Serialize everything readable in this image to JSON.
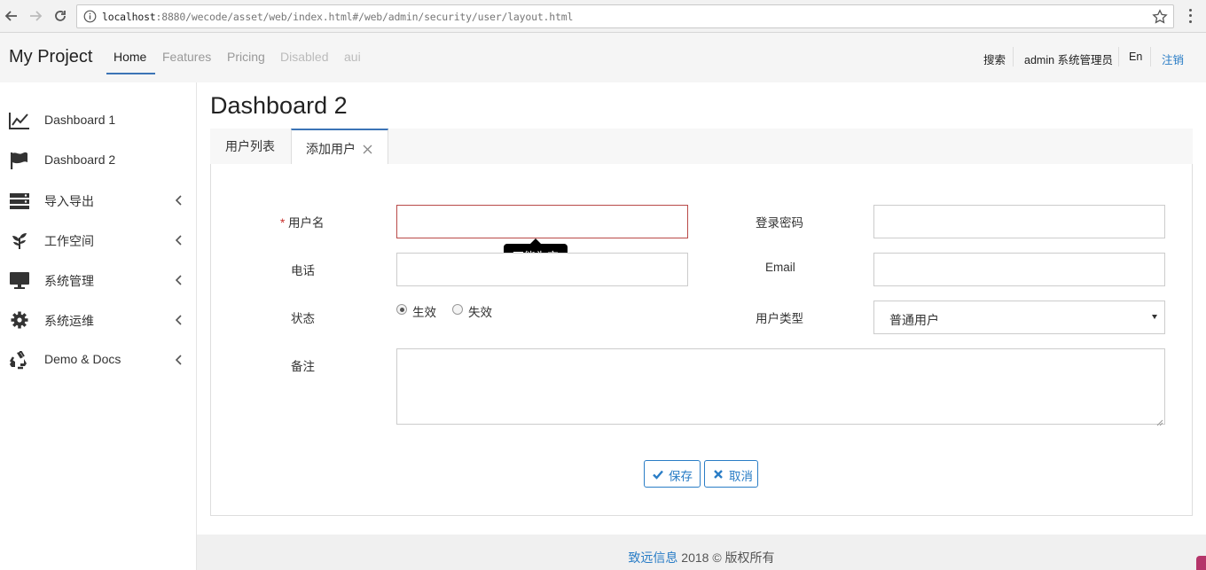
{
  "browser": {
    "url_host": "localhost",
    "url_rest": ":8880/wecode/asset/web/index.html#/web/admin/security/user/layout.html"
  },
  "navbar": {
    "brand": "My Project",
    "links": [
      {
        "label": "Home",
        "state": "active"
      },
      {
        "label": "Features",
        "state": "normal"
      },
      {
        "label": "Pricing",
        "state": "normal"
      },
      {
        "label": "Disabled",
        "state": "disabled"
      },
      {
        "label": "aui",
        "state": "disabled"
      }
    ],
    "search": "搜索",
    "user": "admin 系统管理员",
    "lang": "En",
    "logout": "注销"
  },
  "sidebar": {
    "items": [
      {
        "label": "Dashboard 1",
        "icon": "line-chart-icon",
        "expandable": false
      },
      {
        "label": "Dashboard 2",
        "icon": "flag-icon",
        "expandable": false
      },
      {
        "label": "导入导出",
        "icon": "server-icon",
        "expandable": true
      },
      {
        "label": "工作空间",
        "icon": "leaf-icon",
        "expandable": true
      },
      {
        "label": "系统管理",
        "icon": "desktop-icon",
        "expandable": true
      },
      {
        "label": "系统运维",
        "icon": "gear-icon",
        "expandable": true
      },
      {
        "label": "Demo & Docs",
        "icon": "recycle-icon",
        "expandable": true
      }
    ]
  },
  "main": {
    "title": "Dashboard 2",
    "tabs": [
      {
        "label": "用户列表",
        "active": false
      },
      {
        "label": "添加用户",
        "active": true,
        "closable": true
      }
    ]
  },
  "form": {
    "username": {
      "label": "用户名",
      "required_mark": "*",
      "value": "",
      "error": "不能为空"
    },
    "password": {
      "label": "登录密码",
      "value": ""
    },
    "phone": {
      "label": "电话",
      "value": ""
    },
    "email": {
      "label": "Email",
      "value": ""
    },
    "status": {
      "label": "状态",
      "options": [
        "生效",
        "失效"
      ],
      "selected": "生效"
    },
    "user_type": {
      "label": "用户类型",
      "selected": "普通用户"
    },
    "remark": {
      "label": "备注",
      "value": ""
    },
    "save_label": "保存",
    "cancel_label": "取消"
  },
  "footer": {
    "company": "致远信息",
    "rest": " 2018 © 版权所有"
  },
  "colors": {
    "accent": "#2a7dc6",
    "error": "#b94a48",
    "nav_underline": "#3c74b6"
  }
}
